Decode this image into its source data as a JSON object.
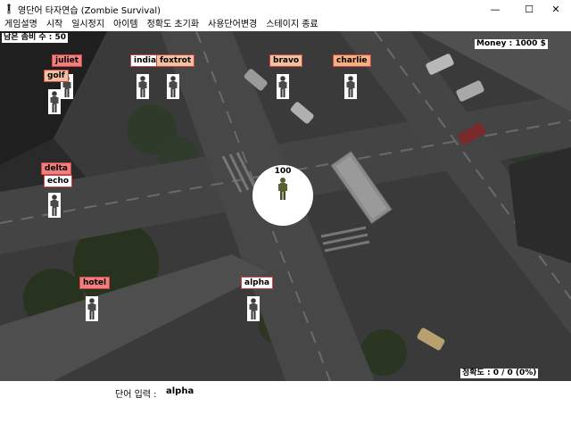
{
  "window": {
    "title": "영단어 타자연습 (Zombie Survival)",
    "minimize_glyph": "—",
    "maximize_glyph": "☐",
    "close_glyph": "✕"
  },
  "menu": [
    "게임설명",
    "시작",
    "일시정지",
    "아이템",
    "정확도 초기화",
    "사용단어변경",
    "스테이지 종료"
  ],
  "hud": {
    "remaining_zombies": "남은 좀비 수 : 50",
    "money": "Money : 1000 $",
    "accuracy": "정확도 : 0 / 0 (0%)"
  },
  "player": {
    "hp": "100"
  },
  "zombies": [
    {
      "word": "juliet",
      "label_color": "#f08080"
    },
    {
      "word": "golf",
      "label_color": "#f4c1a0"
    },
    {
      "word": "india",
      "label_color": "#ffffff"
    },
    {
      "word": "foxtrot",
      "label_color": "#f4c1a0"
    },
    {
      "word": "bravo",
      "label_color": "#f4c1a0"
    },
    {
      "word": "charlie",
      "label_color": "#f4b080"
    },
    {
      "word": "delta",
      "label_color": "#f08080"
    },
    {
      "word": "echo",
      "label_color": "#ffffff"
    },
    {
      "word": "hotel",
      "label_color": "#f08080"
    },
    {
      "word": "alpha",
      "label_color": "#ffffff"
    }
  ],
  "input": {
    "label": "단어 입력 :",
    "value": "alpha"
  }
}
